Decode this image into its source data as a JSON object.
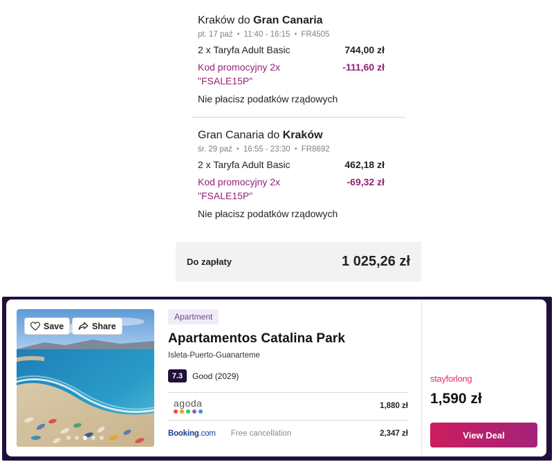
{
  "flights": [
    {
      "from": "Kraków",
      "connector": "do",
      "to": "Gran Canaria",
      "date": "pt. 17 paź",
      "time": "11:40 - 16:15",
      "flight_no": "FR4505",
      "fare_label": "2 x Taryfa Adult Basic",
      "fare_amount": "744,00 zł",
      "promo_label": "Kod promocyjny 2x \"FSALE15P\"",
      "promo_amount": "-111,60 zł",
      "tax_note": "Nie płacisz podatków rządowych"
    },
    {
      "from": "Gran Canaria",
      "connector": "do",
      "to": "Kraków",
      "date": "śr. 29 paź",
      "time": "16:55 - 23:30",
      "flight_no": "FR8692",
      "fare_label": "2 x Taryfa Adult Basic",
      "fare_amount": "462,18 zł",
      "promo_label": "Kod promocyjny 2x \"FSALE15P\"",
      "promo_amount": "-69,32 zł",
      "tax_note": "Nie płacisz podatków rządowych"
    }
  ],
  "total": {
    "label": "Do zapłaty",
    "value": "1 025,26 zł"
  },
  "hotel": {
    "save_label": "Save",
    "share_label": "Share",
    "type": "Apartment",
    "name": "Apartamentos Catalina Park",
    "location": "Isleta-Puerto-Guanarteme",
    "rating_score": "7.3",
    "rating_text": "Good (2029)",
    "photo_count": 5,
    "photo_active_index": 3,
    "providers": [
      {
        "logo_text": "agoda",
        "price": "1,880 zł",
        "dot_colors": [
          "#e74c3c",
          "#f39c12",
          "#2ecc71",
          "#9b59b6",
          "#3498db"
        ]
      },
      {
        "logo_text_main": "Booking",
        "logo_text_suffix": ".com",
        "note": "Free cancellation",
        "price": "2,347 zł"
      }
    ],
    "deal": {
      "provider": "stayforlong",
      "price": "1,590 zł",
      "button_label": "View Deal"
    }
  },
  "colors": {
    "promo": "#94207a",
    "frame": "#21103a",
    "button_start": "#cc1d5e",
    "button_end": "#a3237a",
    "stayforlong": "#e6316e",
    "booking_blue": "#1a3d8f"
  },
  "icons": {
    "save": "heart-icon",
    "share": "share-arrow-icon"
  }
}
